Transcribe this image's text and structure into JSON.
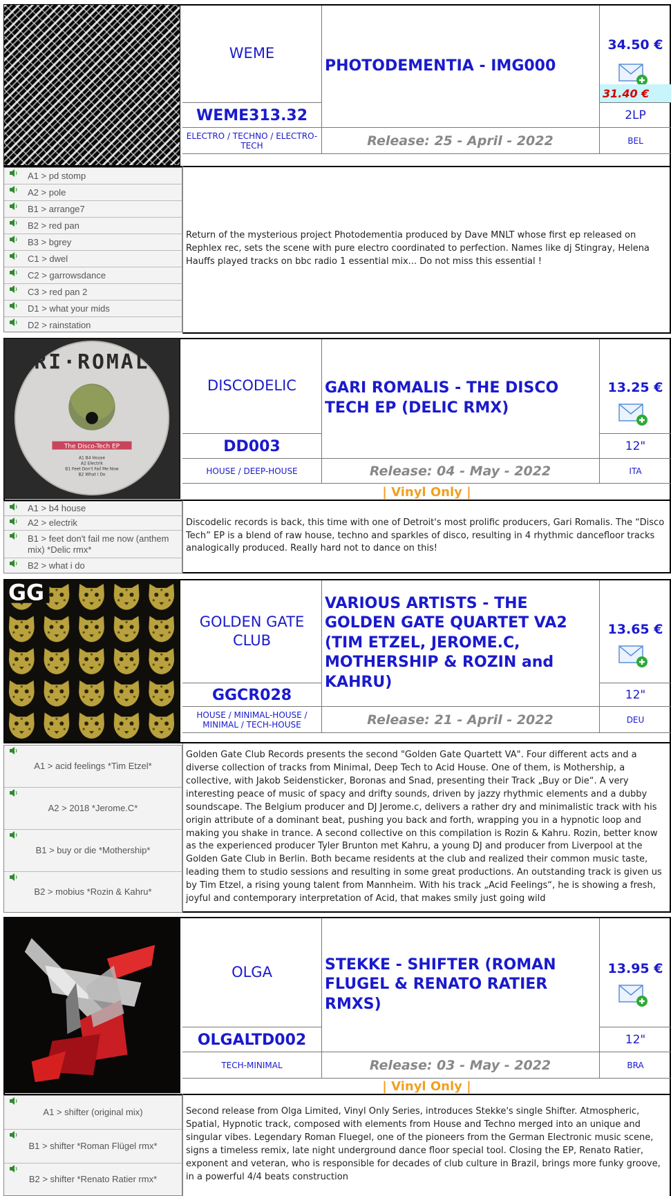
{
  "products": [
    {
      "label": "WEME",
      "catno": "WEME313.32",
      "genre": "ELECTRO / TECHNO / ELECTRO-TECH",
      "title": "PHOTODEMENTIA - IMG000",
      "price": "34.50 €",
      "discount_price": "31.40 €",
      "format": "2LP",
      "release": "Release: 25 - April - 2022",
      "country": "BEL",
      "vinyl_only": "",
      "tracks": [
        "A1 > pd stomp",
        "A2 > pole",
        "B1 > arrange7",
        "B2 > red pan",
        "B3 > bgrey",
        "C1 > dwel",
        "C2 > garrowsdance",
        "C3 > red pan 2",
        "D1 > what your mids",
        "D2 > rainstation"
      ],
      "description": "Return of the mysterious project Photodementia produced by Dave MNLT whose first ep released on Rephlex rec, sets the scene with pure electro coordinated to perfection. Names like dj Stingray, Helena Hauffs played tracks on bbc radio 1 essential mix... Do not miss this essential !"
    },
    {
      "label": "DISCODELIC",
      "catno": "DD003",
      "genre": "HOUSE / DEEP-HOUSE",
      "title": "GARI ROMALIS - THE DISCO TECH EP (DELIC RMX)",
      "price": "13.25 €",
      "discount_price": "",
      "format": "12\"",
      "release": "Release: 04 - May - 2022",
      "country": "ITA",
      "vinyl_only": "| Vinyl Only |",
      "tracks": [
        "A1 > b4 house",
        "A2 > electrik",
        "B1 > feet don't fail me now (anthem mix) *Delic rmx*",
        "B2 > what i do"
      ],
      "description": "Discodelic records is back, this time with one of Detroit's most prolific producers, Gari Romalis. The “Disco Tech” EP is a blend of raw house, techno and sparkles of disco, resulting in 4 rhythmic dancefloor tracks analogically produced. Really hard not to dance on this!"
    },
    {
      "label": "GOLDEN GATE CLUB",
      "catno": "GGCR028",
      "genre": "HOUSE / MINIMAL-HOUSE / MINIMAL / TECH-HOUSE",
      "title": "VARIOUS ARTISTS - THE GOLDEN GATE QUARTET VA2 (TIM ETZEL, JEROME.C, MOTHERSHIP & ROZIN and KAHRU)",
      "price": "13.65 €",
      "discount_price": "",
      "format": "12\"",
      "release": "Release: 21 - April - 2022",
      "country": "DEU",
      "vinyl_only": "",
      "tracks": [
        "A1 > acid feelings *Tim Etzel*",
        "A2 > 2018 *Jerome.C*",
        "B1 > buy or die *Mothership*",
        "B2 > mobius *Rozin & Kahru*"
      ],
      "description": "Golden Gate Club Records presents the second \"Golden Gate Quartett VA\". Four different acts and a diverse collection of tracks from Minimal, Deep Tech to Acid House. One of them, is Mothership, a collective, with Jakob Seidensticker, Boronas and Snad, presenting their Track „Buy or Die“. A very interesting peace of music of spacy and drifty sounds, driven by jazzy rhythmic elements and a dubby soundscape. The Belgium producer and DJ Jerome.c, delivers a rather dry and minimalistic track with his origin attribute of a dominant beat, pushing you back and forth, wrapping you in a hypnotic loop and making you shake in trance. A second collective on this compilation is Rozin & Kahru. Rozin, better know as the experienced producer Tyler Brunton met Kahru, a young DJ and producer from Liverpool at the Golden Gate Club in Berlin. Both became residents at the club and realized their common music taste, leading them to studio sessions and resulting in some great productions. An outstanding track is given us by Tim Etzel, a rising young talent from Mannheim. With his track „Acid Feelings“, he is showing a fresh, joyful and contemporary interpretation of Acid, that makes smily just going wild"
    },
    {
      "label": "OLGA",
      "catno": "OLGALTD002",
      "genre": "TECH-MINIMAL",
      "title": "STEKKE - SHIFTER (ROMAN FLUGEL & RENATO RATIER RMXS)",
      "price": "13.95 €",
      "discount_price": "",
      "format": "12\"",
      "release": "Release: 03 - May - 2022",
      "country": "BRA",
      "vinyl_only": "| Vinyl Only |",
      "tracks": [
        "A1 > shifter (original mix)",
        "B1 > shifter *Roman Flügel rmx*",
        "B2 > shifter *Renato Ratier rmx*"
      ],
      "description": "Second release from Olga Limited, Vinyl Only Series, introduces Stekke's single Shifter. Atmospheric, Spatial, Hypnotic track, composed with elements from House and Techno merged into an unique and singular vibes. Legendary Roman Fluegel, one of the pioneers from the German Electronic music scene, signs a timeless remix, late night underground dance floor special tool. Closing the EP, Renato Ratier, exponent and veteran, who is responsible for decades of club culture in Brazil, brings more funky groove, in a powerful 4/4 beats construction"
    }
  ],
  "icons": {
    "mail": "mail-add-icon",
    "speaker": "speaker-icon"
  },
  "colors": {
    "link": "#1a1acd",
    "release": "#888888",
    "vinyl": "#f0a020",
    "discount": "#d40000",
    "discount_bg": "#c8f4fb"
  }
}
